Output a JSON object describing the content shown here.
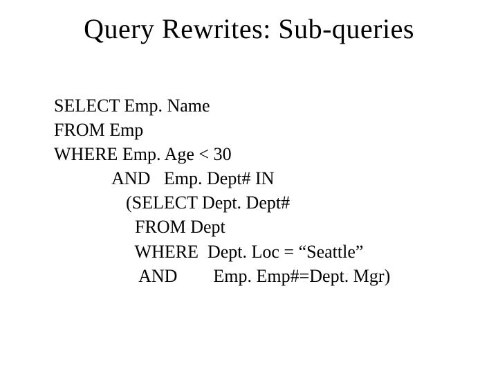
{
  "title": "Query Rewrites: Sub-queries",
  "code": {
    "line1": "SELECT Emp. Name",
    "line2": "FROM Emp",
    "line3": "WHERE Emp. Age < 30",
    "line4": "             AND   Emp. Dept# IN",
    "line5": "                (SELECT Dept. Dept#",
    "line6": "                  FROM Dept",
    "line7": "                  WHERE  Dept. Loc = “Seattle”",
    "line8": "                   AND        Emp. Emp#=Dept. Mgr)"
  }
}
